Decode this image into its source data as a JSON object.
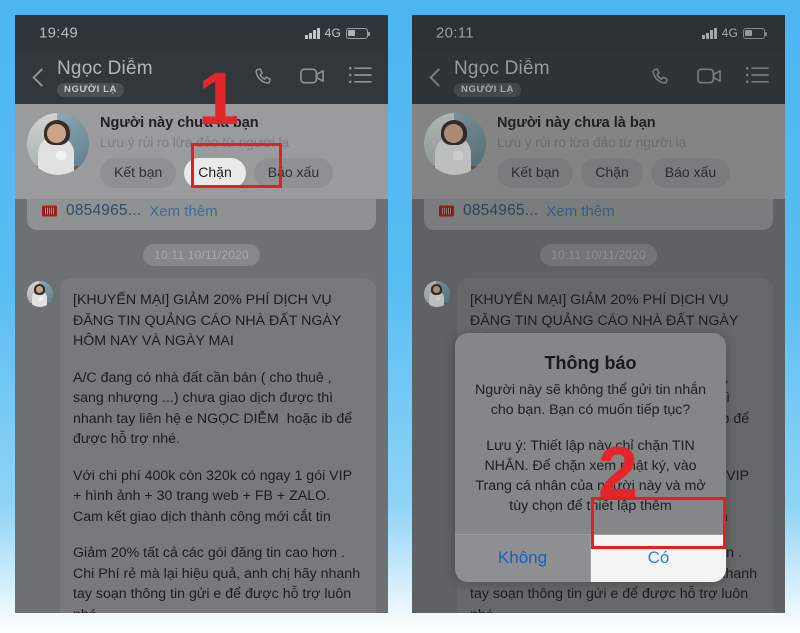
{
  "meta": {
    "background_color": "#4cb5f0",
    "annotation_color": "#e3262a",
    "highlight_border_color": "#ee1b1b"
  },
  "panels": [
    {
      "id": "step-1",
      "statusbar": {
        "clock": "19:49",
        "network": "4G",
        "signal_bars": 4,
        "battery_percent": 38
      },
      "header": {
        "peer_name": "Ngọc Diễm",
        "peer_badge": "NGƯỜI LẠ",
        "icons": [
          "back-icon",
          "phone-call-icon",
          "video-call-icon",
          "menu-list-icon"
        ]
      },
      "warning": {
        "title": "Người này chưa là bạn",
        "subtitle": "Lưu ý rủi ro lừa đảo từ người lạ",
        "buttons": [
          {
            "label": "Kết bạn",
            "selected": false
          },
          {
            "label": "Chặn",
            "selected": true
          },
          {
            "label": "Báo xấu",
            "selected": false
          }
        ]
      },
      "number_row": {
        "number": "0854965...",
        "link": "Xem thêm"
      },
      "conversation": {
        "daystamp": "10:11 10/11/2020",
        "message_paragraphs": [
          "[KHUYẾN MẠI] GIẢM 20% PHÍ DỊCH VỤ ĐĂNG TIN QUẢNG CÁO NHÀ ĐẤT NGÀY HÔM NAY VÀ NGÀY MAI",
          "A/C đang có nhà đất cần bán ( cho thuê , sang nhượng ...) chưa giao dịch được thì nhanh tay liên hệ e NGỌC DIỄM  hoặc ib để được hỗ trợ nhé.",
          "Với chi phí 400k còn 320k có ngay 1 gói VIP + hình ảnh + 30 trang web + FB + ZALO. Cam kết giao dịch thành công mới cắt tin",
          "Giảm 20% tất cả các gói đăng tin cao hơn . Chi Phí rẻ mà lại hiệu quả, anh chị hãy nhanh tay soạn thông tin gửi e để được hỗ trợ luôn nhé."
        ]
      },
      "dialog": null,
      "annotation": {
        "number": "1"
      }
    },
    {
      "id": "step-2",
      "statusbar": {
        "clock": "20:11",
        "network": "4G",
        "signal_bars": 4,
        "battery_percent": 38
      },
      "header": {
        "peer_name": "Ngọc Diễm",
        "peer_badge": "NGƯỜI LẠ",
        "icons": [
          "back-icon",
          "phone-call-icon",
          "video-call-icon",
          "menu-list-icon"
        ]
      },
      "warning": {
        "title": "Người này chưa là bạn",
        "subtitle": "Lưu ý rủi ro lừa đảo từ người lạ",
        "buttons": [
          {
            "label": "Kết bạn",
            "selected": false
          },
          {
            "label": "Chặn",
            "selected": false
          },
          {
            "label": "Báo xấu",
            "selected": false
          }
        ]
      },
      "number_row": {
        "number": "0854965...",
        "link": "Xem thêm"
      },
      "conversation": {
        "daystamp": "10:11 10/11/2020",
        "message_paragraphs": [
          "[KHUYẾN MẠI] GIẢM 20% PHÍ DỊCH VỤ ĐĂNG TIN QUẢNG CÁO NHÀ ĐẤT NGÀY HÔM NAY VÀ NGÀY MAI",
          "A/C đang có nhà đất cần bán ( cho thuê , sang nhượng ...) chưa giao dịch được thì nhanh tay liên hệ e NGỌC DIỄM  hoặc ib để được hỗ trợ nhé.",
          "Với chi phí 400k còn 320k có ngay 1 gói VIP + hình ảnh + 30 trang web + FB + ZALO. Cam kết giao dịch thành công mới cắt tin",
          "Giảm 20% tất cả các gói đăng tin cao hơn . Chi Phí rẻ mà lại hiệu quả, anh chị hãy nhanh tay soạn thông tin gửi e để được hỗ trợ luôn nhé."
        ]
      },
      "dialog": {
        "title": "Thông báo",
        "text": "Người này sẽ không thể gửi tin nhắn cho bạn. Bạn có muốn tiếp tục?",
        "note": "Lưu ý: Thiết lập này chỉ chặn TIN NHẮN. Để chặn xem nhật ký, vào Trang cá nhân của người này và mở tùy chọn để thiết lập thêm",
        "buttons": [
          {
            "label": "Không",
            "highlighted": false
          },
          {
            "label": "Có",
            "highlighted": true
          }
        ]
      },
      "annotation": {
        "number": "2"
      }
    }
  ]
}
